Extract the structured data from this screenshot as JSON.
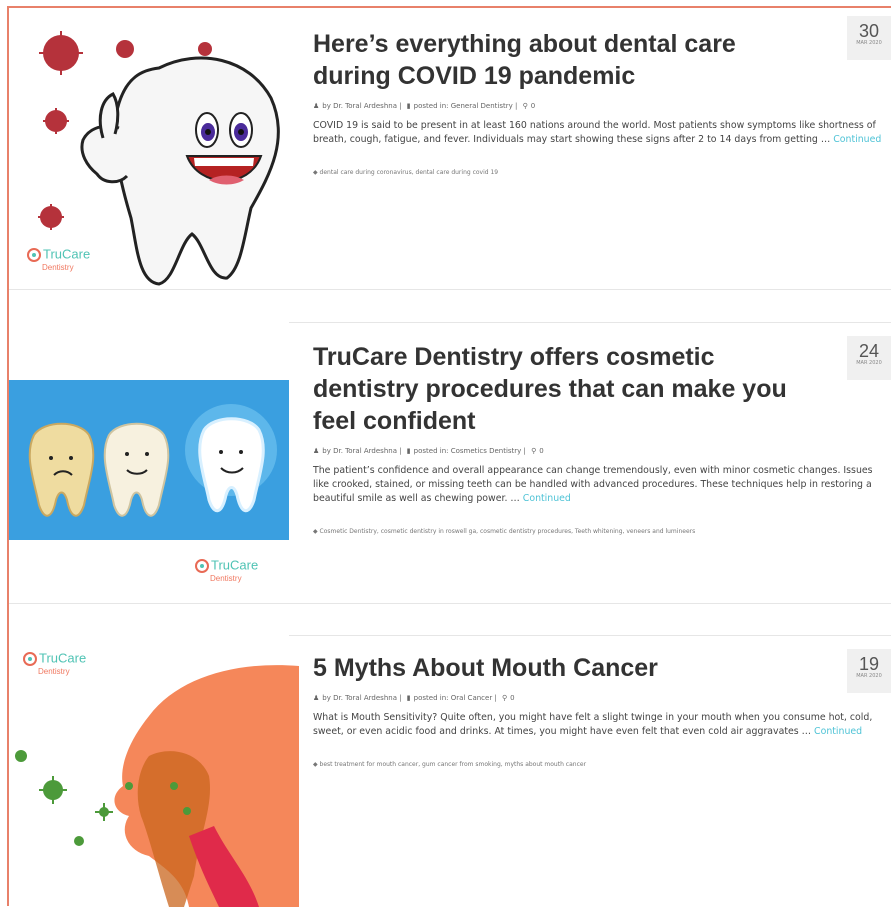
{
  "posts": [
    {
      "title": "Here’s everything about dental care during COVID 19 pandemic",
      "author": "by Dr. Toral Ardeshna |",
      "category": "posted in: General Dentistry |",
      "comments": "0",
      "excerpt": "COVID 19 is said to be present in at least 160 nations around the world. Most patients show symptoms like shortness of breath, cough, fatigue, and fever. Individuals may start showing these signs after 2 to 14 days from getting …",
      "more": "Continued",
      "tags": "dental care during coronavirus, dental care during covid 19",
      "day": "30",
      "month": "MAR 2020"
    },
    {
      "title": "TruCare Dentistry offers cosmetic dentistry procedures that can make you feel confident",
      "author": "by Dr. Toral Ardeshna |",
      "category": "posted in: Cosmetics Dentistry |",
      "comments": "0",
      "excerpt": "The patient’s confidence and overall appearance can change tremendously, even with minor cosmetic changes. Issues like crooked, stained, or missing teeth can be handled with advanced procedures. These techniques help in restoring a beautiful smile as well as chewing power. …",
      "more": "Continued",
      "tags": "Cosmetic Dentistry, cosmetic dentistry in roswell ga, cosmetic dentistry procedures, Teeth whitening, veneers and lumineers",
      "day": "24",
      "month": "MAR 2020"
    },
    {
      "title": "5 Myths About Mouth Cancer",
      "author": "by Dr. Toral Ardeshna |",
      "category": "posted in: Oral Cancer |",
      "comments": "0",
      "excerpt": "What is Mouth Sensitivity? Quite often, you might have felt a slight twinge in your mouth when you consume hot, cold, sweet, or even acidic food and drinks. At times, you might have even felt that even cold air aggravates …",
      "more": "Continued",
      "tags": "best treatment for mouth cancer, gum cancer from smoking, myths about mouth cancer",
      "day": "19",
      "month": "MAR 2020"
    }
  ],
  "brand": {
    "name": "TruCare",
    "sub": "Dentistry"
  },
  "icons": {
    "author": "user-icon",
    "category": "folder-icon",
    "comments": "comment-icon",
    "tag": "tag-icon"
  },
  "colors": {
    "accent": "#4fc3d6",
    "border": "#e8816a",
    "brand_teal": "#4fc3b4"
  }
}
